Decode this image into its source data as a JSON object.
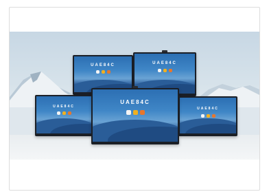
{
  "banner": {
    "displays": [
      {
        "id": "back-left",
        "brand": "UAE84C"
      },
      {
        "id": "back-right",
        "brand": "UAE84C"
      },
      {
        "id": "front-left",
        "brand": "UAE84C"
      },
      {
        "id": "front-center",
        "brand": "UAE84C"
      },
      {
        "id": "front-right",
        "brand": "UAE84C"
      }
    ],
    "icons": [
      "pen-app-icon",
      "whiteboard-app-icon",
      "folder-app-icon"
    ],
    "colors": {
      "sky": "#c7d7e4",
      "screen_blue": "#2c6fb3",
      "bezel": "#1b1f26",
      "app_yellow": "#f2b01e",
      "app_orange": "#e8762b"
    }
  }
}
